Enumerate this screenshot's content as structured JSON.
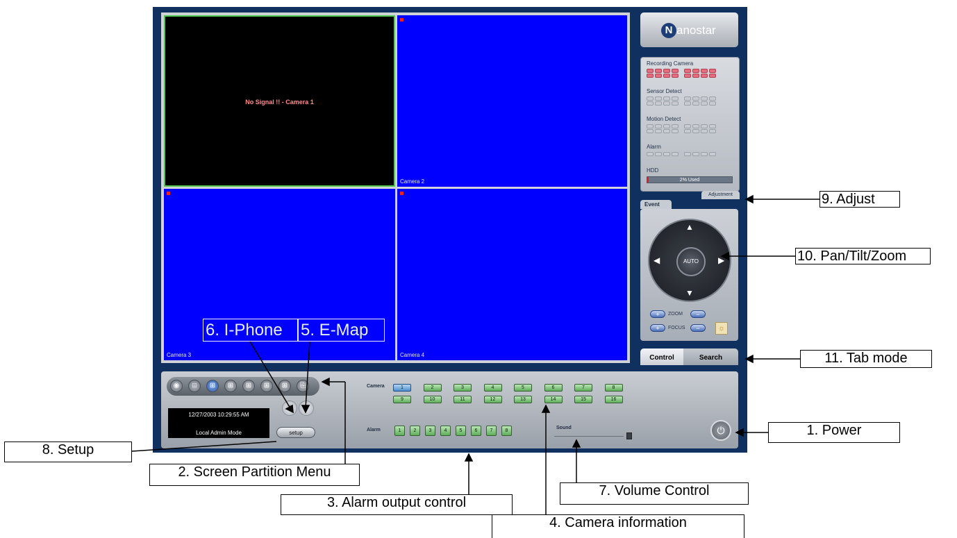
{
  "cameras": [
    {
      "label": "",
      "status": "No Signal !! - Camera 1",
      "color": "#000000",
      "selected": true,
      "recording": false
    },
    {
      "label": "Camera 2",
      "color": "#0000fe",
      "recording": true
    },
    {
      "label": "Camera 3",
      "color": "#0000fe",
      "recording": true
    },
    {
      "label": "Camera 4",
      "color": "#0000fe",
      "recording": true
    }
  ],
  "overlays": {
    "iphone": "6. I-Phone",
    "emap": "5. E-Map"
  },
  "logo": {
    "mark": "N",
    "text": "anostar"
  },
  "status_panel": {
    "recording_label": "Recording Camera",
    "sensor_label": "Sensor Detect",
    "motion_label": "Motion Detect",
    "alarm_label": "Alarm",
    "hdd_label": "HDD",
    "hdd_text": "2% Used",
    "hdd_fraction": 0.02
  },
  "tabs": {
    "adjustment": "Adjustment",
    "event": "Event",
    "control": "Control",
    "search": "Search"
  },
  "ptz": {
    "auto": "AUTO",
    "zoom": "ZOOM",
    "focus": "FOCUS",
    "plus": "+",
    "minus": "−"
  },
  "partition_icons": [
    "camera-single-icon",
    "single-view-icon",
    "quad-view-icon",
    "six-view-icon",
    "nine-view-icon",
    "ten-view-icon",
    "sixteen-view-icon",
    "sequence-icon"
  ],
  "selected_partition": 2,
  "clock": {
    "datetime": "12/27/2003 10:29:55 AM",
    "mode": "Local Admin Mode"
  },
  "setup_label": "setup",
  "camera_label": "Camera",
  "camera_buttons": [
    "1",
    "2",
    "3",
    "4",
    "5",
    "6",
    "7",
    "8",
    "9",
    "10",
    "11",
    "12",
    "13",
    "14",
    "15",
    "16"
  ],
  "selected_camera": "1",
  "alarm_label": "Alarm",
  "alarm_buttons": [
    "1",
    "2",
    "3",
    "4",
    "5",
    "6",
    "7",
    "8"
  ],
  "sound_label": "Sound",
  "volume": 1.0,
  "callouts": {
    "power": "1. Power",
    "partition": "2. Screen Partition Menu",
    "alarm_output": "3. Alarm output control",
    "camera_info": "4. Camera information",
    "volume": "7. Volume Control",
    "setup": "8. Setup",
    "adjust": "9. Adjust",
    "ptz": "10. Pan/Tilt/Zoom",
    "tab_mode": "11. Tab mode"
  },
  "colors": {
    "app_bg": "#10315f",
    "video_blue": "#0000fe",
    "selected_border": "#50c850",
    "record_led": "#e56e80"
  }
}
